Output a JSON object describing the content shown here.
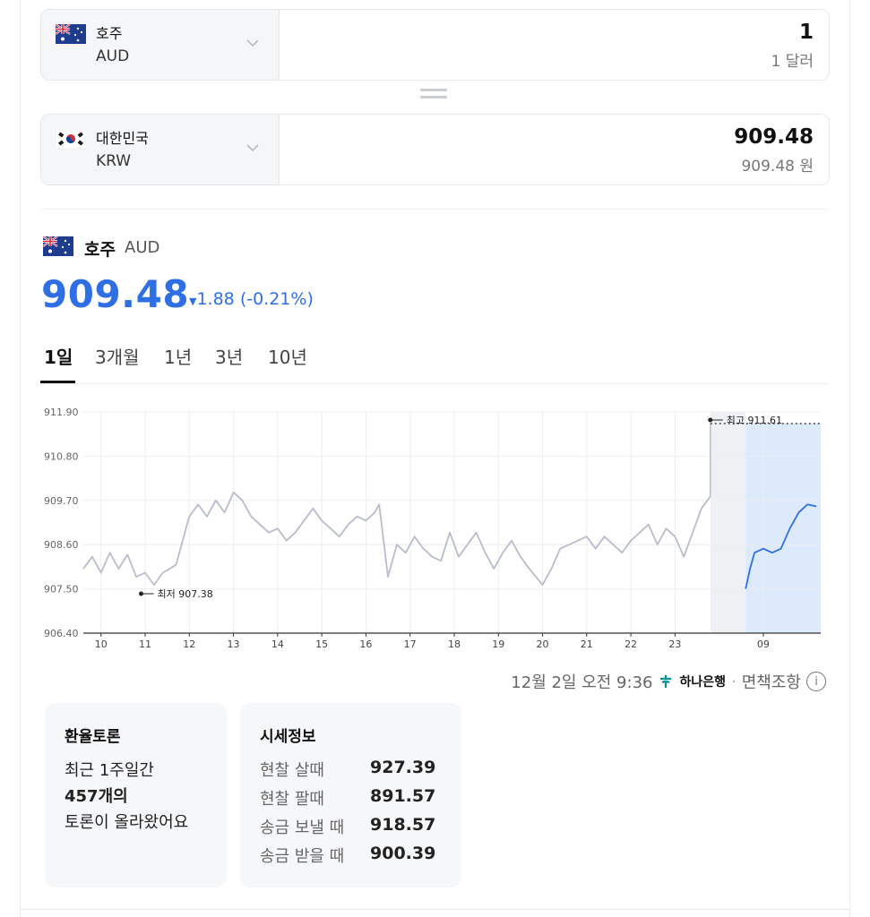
{
  "converter": {
    "from": {
      "name": "호주",
      "code": "AUD",
      "amount": "1",
      "amount_text": "1 달러"
    },
    "to": {
      "name": "대한민국",
      "code": "KRW",
      "amount": "909.48",
      "amount_text": "909.48 원"
    }
  },
  "header": {
    "name": "호주",
    "code": "AUD",
    "rate": "909.48",
    "change": "1.88 (-0.21%)"
  },
  "tabs": [
    "1일",
    "3개월",
    "1년",
    "3년",
    "10년"
  ],
  "active_tab": "1일",
  "updated": {
    "time": "12월 2일 오전 9:36",
    "bank": "하나은행",
    "disclaimer": "면책조항"
  },
  "discussion": {
    "title": "환율토론",
    "line1": "최근 1주일간",
    "count": "457개의",
    "line3": "토론이 올라왔어요"
  },
  "market_info": {
    "title": "시세정보",
    "rows": [
      {
        "label": "현찰 살때",
        "value": "927.39"
      },
      {
        "label": "현찰 팔때",
        "value": "891.57"
      },
      {
        "label": "송금 보낼 때",
        "value": "918.57"
      },
      {
        "label": "송금 받을 때",
        "value": "900.39"
      }
    ]
  },
  "colors": {
    "accent": "#2f6fe4",
    "history_line": "#b9bccb",
    "today_line": "#2f6fe4",
    "today_fill": "#dceafc"
  },
  "chart_data": {
    "type": "line",
    "ylim": [
      906.4,
      911.9
    ],
    "yticks": [
      "911.90",
      "910.80",
      "909.70",
      "908.60",
      "907.50",
      "906.40"
    ],
    "xticks": [
      "10",
      "11",
      "12",
      "13",
      "14",
      "15",
      "16",
      "17",
      "18",
      "19",
      "20",
      "21",
      "22",
      "23",
      "09"
    ],
    "night_marker": "moon-icon",
    "high": {
      "label": "최고 911.61",
      "value": 911.61
    },
    "low": {
      "label": "최저 907.38",
      "value": 907.38
    },
    "series": [
      {
        "points": [
          [
            9.6,
            908.0
          ],
          [
            9.8,
            908.3
          ],
          [
            10.0,
            907.9
          ],
          [
            10.2,
            908.4
          ],
          [
            10.4,
            908.0
          ],
          [
            10.6,
            908.35
          ],
          [
            10.8,
            907.8
          ],
          [
            11.0,
            907.9
          ],
          [
            11.2,
            907.6
          ],
          [
            11.4,
            907.9
          ],
          [
            11.7,
            908.1
          ],
          [
            11.9,
            908.9
          ],
          [
            12.0,
            909.3
          ],
          [
            12.2,
            909.6
          ],
          [
            12.4,
            909.3
          ],
          [
            12.6,
            909.7
          ],
          [
            12.8,
            909.4
          ],
          [
            13.0,
            909.9
          ],
          [
            13.2,
            909.7
          ],
          [
            13.4,
            909.3
          ],
          [
            13.6,
            909.1
          ],
          [
            13.8,
            908.9
          ],
          [
            14.0,
            909.0
          ],
          [
            14.2,
            908.7
          ],
          [
            14.4,
            908.9
          ],
          [
            14.6,
            909.2
          ],
          [
            14.8,
            909.5
          ],
          [
            15.0,
            909.2
          ],
          [
            15.2,
            909.0
          ],
          [
            15.4,
            908.8
          ],
          [
            15.6,
            909.1
          ],
          [
            15.8,
            909.3
          ],
          [
            16.0,
            909.2
          ],
          [
            16.2,
            909.4
          ],
          [
            16.3,
            909.6
          ],
          [
            16.5,
            907.8
          ],
          [
            16.7,
            908.6
          ],
          [
            16.9,
            908.4
          ],
          [
            17.1,
            908.8
          ],
          [
            17.3,
            908.5
          ],
          [
            17.5,
            908.3
          ],
          [
            17.7,
            908.2
          ],
          [
            17.9,
            908.9
          ],
          [
            18.1,
            908.3
          ],
          [
            18.3,
            908.6
          ],
          [
            18.5,
            908.9
          ],
          [
            18.7,
            908.4
          ],
          [
            18.9,
            908.0
          ],
          [
            19.1,
            908.4
          ],
          [
            19.3,
            908.7
          ],
          [
            19.5,
            908.3
          ],
          [
            19.7,
            908.0
          ],
          [
            20.0,
            907.6
          ],
          [
            20.2,
            908.0
          ],
          [
            20.4,
            908.5
          ],
          [
            20.6,
            908.6
          ],
          [
            20.8,
            908.7
          ],
          [
            21.0,
            908.8
          ],
          [
            21.2,
            908.5
          ],
          [
            21.4,
            908.8
          ],
          [
            21.6,
            908.6
          ],
          [
            21.8,
            908.4
          ],
          [
            22.0,
            908.7
          ],
          [
            22.2,
            908.9
          ],
          [
            22.4,
            909.1
          ],
          [
            22.6,
            908.6
          ],
          [
            22.8,
            909.0
          ],
          [
            23.0,
            908.8
          ],
          [
            23.2,
            908.3
          ],
          [
            23.4,
            908.9
          ],
          [
            23.6,
            909.5
          ],
          [
            23.8,
            909.8
          ]
        ]
      },
      {
        "points": [
          [
            24.6,
            907.5
          ],
          [
            24.7,
            908.0
          ],
          [
            24.8,
            908.4
          ],
          [
            25.0,
            908.5
          ],
          [
            25.2,
            908.4
          ],
          [
            25.4,
            908.5
          ],
          [
            25.6,
            909.0
          ],
          [
            25.8,
            909.4
          ],
          [
            26.0,
            909.6
          ],
          [
            26.2,
            909.55
          ]
        ]
      }
    ]
  }
}
